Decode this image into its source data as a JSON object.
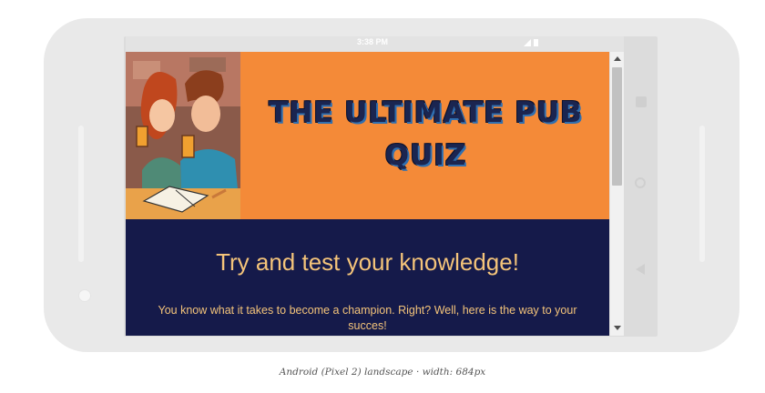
{
  "status_bar": {
    "time": "3:38 PM"
  },
  "hero": {
    "title_line1": "THE ULTIMATE PUB",
    "title_line2": "QUIZ",
    "background_color": "#f48a38"
  },
  "content": {
    "heading": "Try and test your knowledge!",
    "paragraph": "You know what it takes to become a champion. Right? Well, here is the way to your succes!",
    "background_color": "#151a4a",
    "text_color": "#f4c47a"
  },
  "caption": "Android (Pixel 2) landscape · width: 684px",
  "icons": [
    "signal-icon",
    "battery-icon",
    "square-nav-icon",
    "circle-nav-icon",
    "back-nav-icon",
    "scroll-up-icon",
    "scroll-down-icon"
  ]
}
